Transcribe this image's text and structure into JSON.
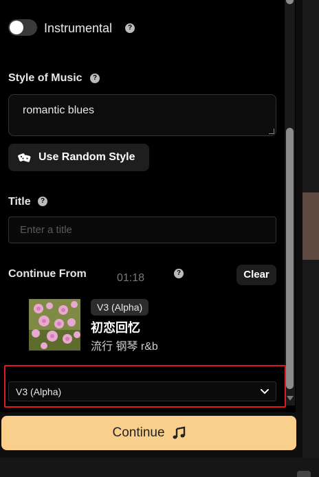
{
  "instrumental": {
    "label": "Instrumental",
    "on": false,
    "icon": "help-icon"
  },
  "style": {
    "label": "Style of Music",
    "value": "romantic blues",
    "random_button": "Use Random Style",
    "random_icon": "dice-icon"
  },
  "title_field": {
    "label": "Title",
    "placeholder": "Enter a title"
  },
  "continue_from": {
    "label": "Continue From",
    "time": "01:18",
    "clear_label": "Clear",
    "song": {
      "badge": "V3 (Alpha)",
      "title": "初恋回忆",
      "tags": "流行 钢琴 r&b"
    }
  },
  "model_select": {
    "value": "V3 (Alpha)",
    "icon": "chevron-down-icon"
  },
  "continue_button": {
    "label": "Continue",
    "icon": "music-note-icon"
  },
  "colors": {
    "accent": "#f9d08b",
    "highlight": "#e01b1b"
  }
}
